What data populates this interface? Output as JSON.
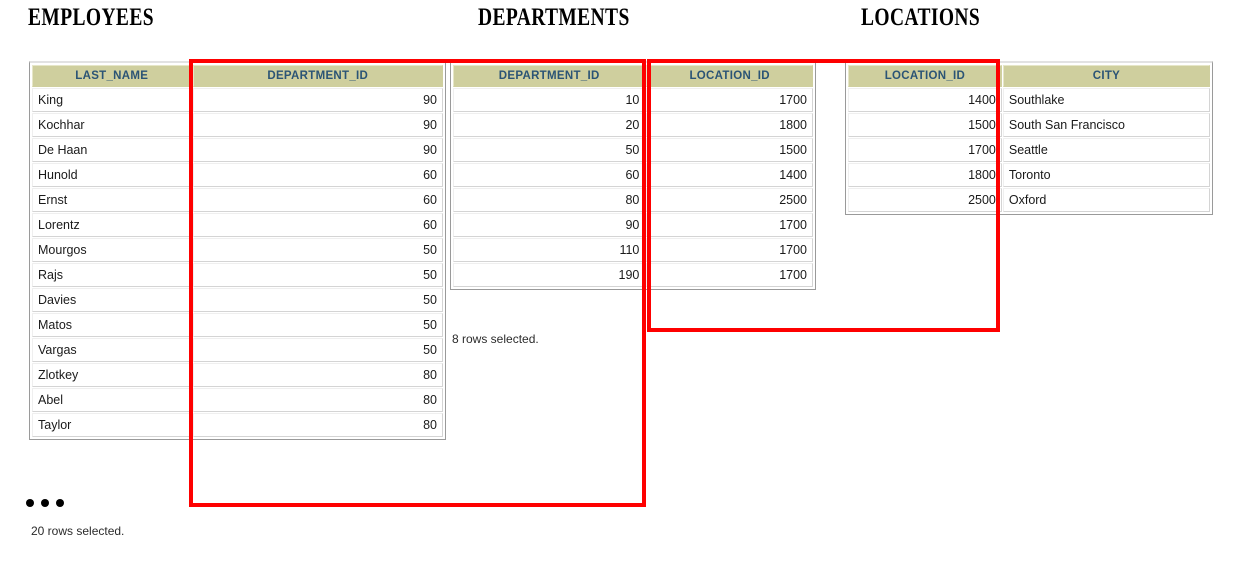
{
  "titles": {
    "employees": "EMPLOYEES",
    "departments": "DEPARTMENTS",
    "locations": "LOCATIONS"
  },
  "colors": {
    "header_background": "#cfcf9e",
    "header_text": "#2b5475",
    "annotation_red": "#fe0000",
    "grid_border": "#9a9a9a",
    "cell_border": "#d4d4d4",
    "page_background": "#ffffff"
  },
  "tables": {
    "employees": {
      "name": "EMPLOYEES",
      "columns": [
        "LAST_NAME",
        "DEPARTMENT_ID"
      ],
      "column_types": [
        "text",
        "num"
      ],
      "rows": [
        [
          "King",
          "90"
        ],
        [
          "Kochhar",
          "90"
        ],
        [
          "De Haan",
          "90"
        ],
        [
          "Hunold",
          "60"
        ],
        [
          "Ernst",
          "60"
        ],
        [
          "Lorentz",
          "60"
        ],
        [
          "Mourgos",
          "50"
        ],
        [
          "Rajs",
          "50"
        ],
        [
          "Davies",
          "50"
        ],
        [
          "Matos",
          "50"
        ],
        [
          "Vargas",
          "50"
        ],
        [
          "Zlotkey",
          "80"
        ],
        [
          "Abel",
          "80"
        ],
        [
          "Taylor",
          "80"
        ]
      ],
      "truncated": true,
      "rows_note": "20 rows selected.",
      "total_rows": 20,
      "rows_shown": 14
    },
    "departments": {
      "name": "DEPARTMENTS",
      "columns": [
        "DEPARTMENT_ID",
        "LOCATION_ID"
      ],
      "column_types": [
        "num",
        "num"
      ],
      "rows": [
        [
          "10",
          "1700"
        ],
        [
          "20",
          "1800"
        ],
        [
          "50",
          "1500"
        ],
        [
          "60",
          "1400"
        ],
        [
          "80",
          "2500"
        ],
        [
          "90",
          "1700"
        ],
        [
          "110",
          "1700"
        ],
        [
          "190",
          "1700"
        ]
      ],
      "truncated": false,
      "rows_note": "8 rows selected.",
      "total_rows": 8,
      "rows_shown": 8
    },
    "locations": {
      "name": "LOCATIONS",
      "columns": [
        "LOCATION_ID",
        "CITY"
      ],
      "column_types": [
        "num",
        "text"
      ],
      "rows": [
        [
          "1400",
          "Southlake"
        ],
        [
          "1500",
          "South San Francisco"
        ],
        [
          "1700",
          "Seattle"
        ],
        [
          "1800",
          "Toronto"
        ],
        [
          "2500",
          "Oxford"
        ]
      ],
      "truncated": false,
      "rows_note": "",
      "total_rows": 5,
      "rows_shown": 5
    }
  },
  "annotations": [
    {
      "id": "join-box-department-id",
      "label": "DEPARTMENT_ID join highlight",
      "joins": [
        "EMPLOYEES.DEPARTMENT_ID",
        "DEPARTMENTS.DEPARTMENT_ID"
      ],
      "color": "#fe0000"
    },
    {
      "id": "join-box-location-id",
      "label": "LOCATION_ID join highlight",
      "joins": [
        "DEPARTMENTS.LOCATION_ID",
        "LOCATIONS.LOCATION_ID"
      ],
      "color": "#fe0000"
    }
  ]
}
